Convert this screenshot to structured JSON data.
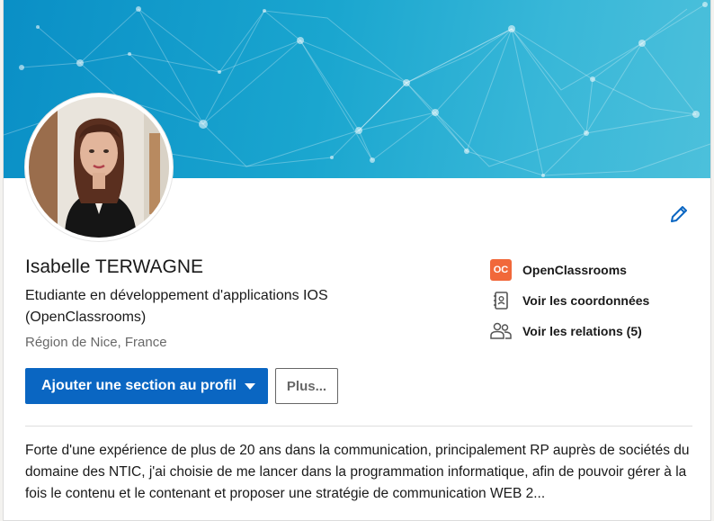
{
  "profile": {
    "name": "Isabelle TERWAGNE",
    "headline": "Etudiante en développement d'applications IOS (OpenClassrooms)",
    "location": "Région de Nice, France",
    "about": "Forte d'une expérience de plus de 20 ans dans la communication, principalement RP auprès de sociétés du domaine des NTIC, j'ai choisie de me lancer dans la programmation informatique, afin de pouvoir gérer à la fois le contenu et le contenant et proposer une stratégie de communication WEB 2..."
  },
  "actions": {
    "add_section_label": "Ajouter une section au profil",
    "more_label": "Plus..."
  },
  "sidebar": {
    "school": {
      "label": "OpenClassrooms",
      "logo_text": "OC",
      "icon": "openclassrooms-logo"
    },
    "contact": {
      "label": "Voir les coordonnées",
      "icon": "address-book-icon"
    },
    "connections": {
      "label": "Voir les relations (5)",
      "icon": "people-icon"
    }
  },
  "colors": {
    "primary": "#0a66c2",
    "banner": "#1aa6cf",
    "oc_orange": "#f1683a"
  }
}
